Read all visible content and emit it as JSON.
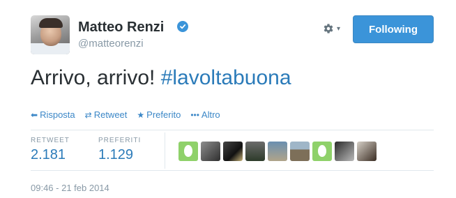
{
  "author": {
    "name": "Matteo Renzi",
    "username": "@matteorenzi",
    "verified": true
  },
  "follow_button": {
    "label": "Following"
  },
  "tweet": {
    "text": "Arrivo, arrivo! ",
    "hashtag": "#lavoltabuona"
  },
  "actions": [
    {
      "icon": "reply-icon",
      "label": "Risposta"
    },
    {
      "icon": "retweet-icon",
      "label": "Retweet"
    },
    {
      "icon": "star-icon",
      "label": "Preferito"
    },
    {
      "icon": "more-icon",
      "label": "Altro"
    }
  ],
  "stats": {
    "retweets": {
      "label": "RETWEET",
      "value": "2.181"
    },
    "favorites": {
      "label": "PREFERITI",
      "value": "1.129"
    }
  },
  "favorited_by": [
    "egg-avatar",
    "photo-avatar",
    "photo-avatar",
    "photo-avatar",
    "photo-avatar",
    "photo-avatar",
    "egg-avatar",
    "photo-avatar",
    "photo-avatar"
  ],
  "timestamp": "09:46 - 21 feb 2014",
  "colors": {
    "accent": "#3b94d9",
    "link": "#2b7bb9",
    "muted": "#8899a6"
  }
}
